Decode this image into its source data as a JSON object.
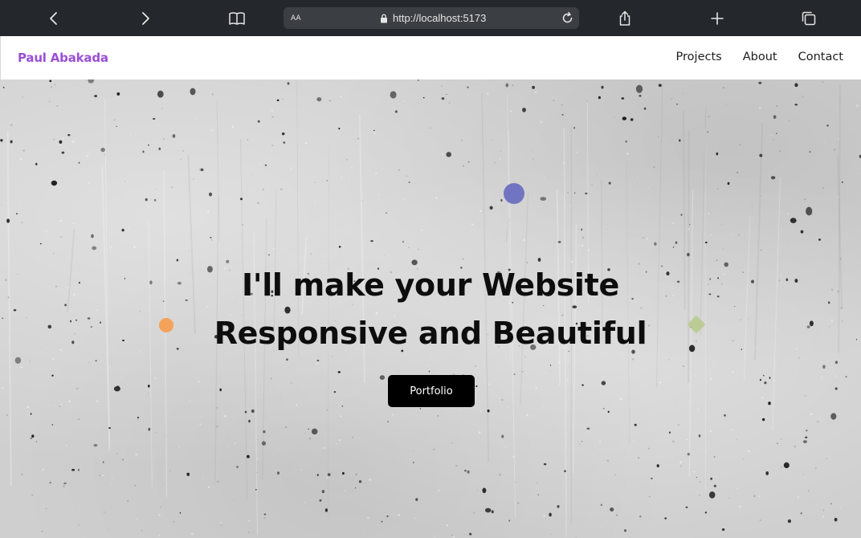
{
  "browser": {
    "url": "http://localhost:5173",
    "text_size_label_big": "A",
    "text_size_label_small": "A",
    "icons": {
      "back": "chevron-left-icon",
      "forward": "chevron-right-icon",
      "reader": "book-icon",
      "lock": "lock-icon",
      "reload": "reload-icon",
      "share": "share-icon",
      "new_tab": "plus-icon",
      "tabs": "tabs-icon"
    }
  },
  "navbar": {
    "brand": "Paul Abakada",
    "links": [
      "Projects",
      "About",
      "Contact"
    ]
  },
  "hero": {
    "title_line1": "I'll make your Website",
    "title_line2": "Responsive and Beautiful",
    "button_label": "Portfolio"
  },
  "colors": {
    "brand": "#9b4fd6",
    "button_bg": "#000000",
    "shape_blue": "#7175c1",
    "shape_orange": "#f4a259",
    "shape_green": "#b9c98c",
    "chrome_bg": "#24272b"
  }
}
